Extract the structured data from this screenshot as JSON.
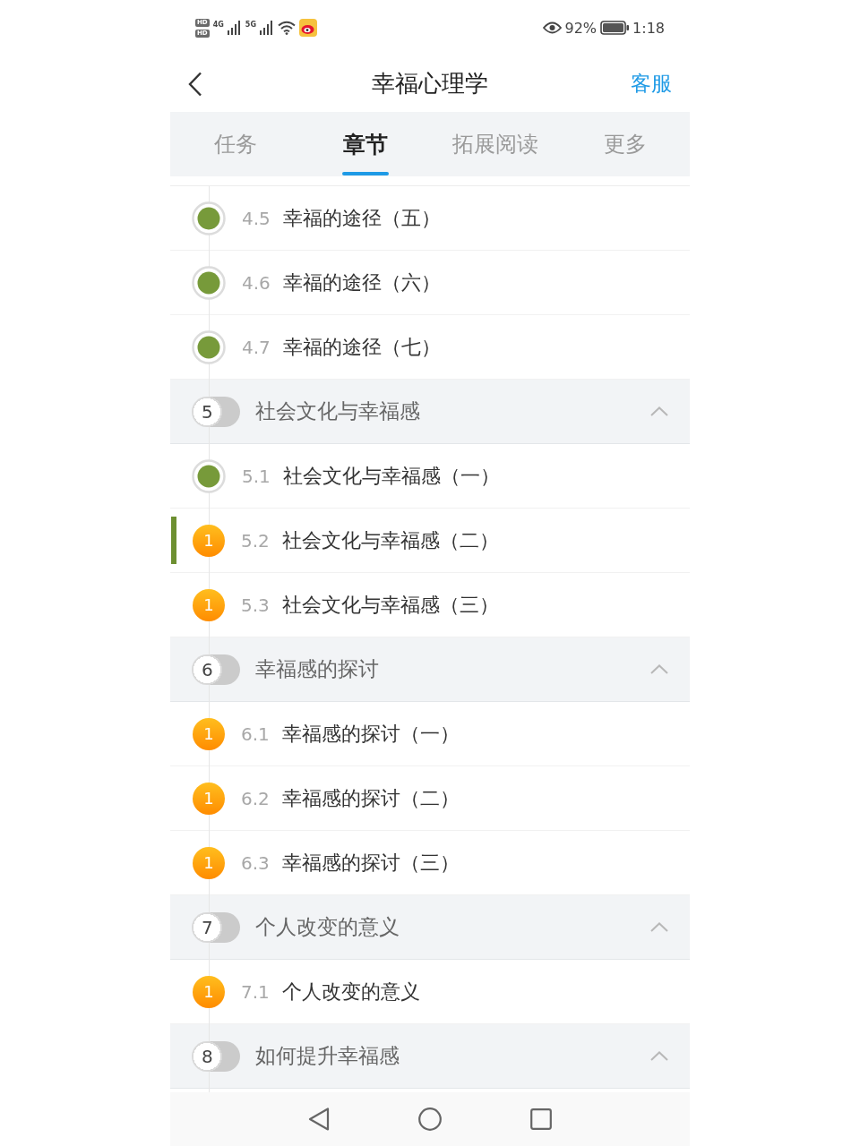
{
  "status_bar": {
    "hd_labels": [
      "HD",
      "HD"
    ],
    "networks": [
      {
        "label": "4G"
      },
      {
        "label": "5G"
      }
    ],
    "battery": "92%",
    "time": "1:18"
  },
  "header": {
    "title": "幸福心理学",
    "action": "客服"
  },
  "tabs": [
    {
      "label": "任务",
      "selected": false
    },
    {
      "label": "章节",
      "selected": true
    },
    {
      "label": "拓展阅读",
      "selected": false
    },
    {
      "label": "更多",
      "selected": false
    }
  ],
  "outline": [
    {
      "kind": "lesson",
      "number": "4.5",
      "title": "幸福的途径（五）",
      "completed": true,
      "selected": false
    },
    {
      "kind": "lesson",
      "number": "4.6",
      "title": "幸福的途径（六）",
      "completed": true,
      "selected": false
    },
    {
      "kind": "lesson",
      "number": "4.7",
      "title": "幸福的途径（七）",
      "completed": true,
      "selected": false
    },
    {
      "kind": "section",
      "number": "5",
      "title": "社会文化与幸福感",
      "expanded": true,
      "children": [
        {
          "kind": "lesson",
          "number": "5.1",
          "title": "社会文化与幸福感（一）",
          "completed": true,
          "selected": false
        },
        {
          "kind": "lesson",
          "number": "5.2",
          "title": "社会文化与幸福感（二）",
          "completed": false,
          "badge": "1",
          "selected": true
        },
        {
          "kind": "lesson",
          "number": "5.3",
          "title": "社会文化与幸福感（三）",
          "completed": false,
          "badge": "1",
          "selected": false
        }
      ]
    },
    {
      "kind": "section",
      "number": "6",
      "title": "幸福感的探讨",
      "expanded": true,
      "children": [
        {
          "kind": "lesson",
          "number": "6.1",
          "title": "幸福感的探讨（一）",
          "completed": false,
          "badge": "1",
          "selected": false
        },
        {
          "kind": "lesson",
          "number": "6.2",
          "title": "幸福感的探讨（二）",
          "completed": false,
          "badge": "1",
          "selected": false
        },
        {
          "kind": "lesson",
          "number": "6.3",
          "title": "幸福感的探讨（三）",
          "completed": false,
          "badge": "1",
          "selected": false
        }
      ]
    },
    {
      "kind": "section",
      "number": "7",
      "title": "个人改变的意义",
      "expanded": true,
      "children": [
        {
          "kind": "lesson",
          "number": "7.1",
          "title": "个人改变的意义",
          "completed": false,
          "badge": "1",
          "selected": false
        }
      ]
    },
    {
      "kind": "section",
      "number": "8",
      "title": "如何提升幸福感",
      "expanded": true
    }
  ]
}
